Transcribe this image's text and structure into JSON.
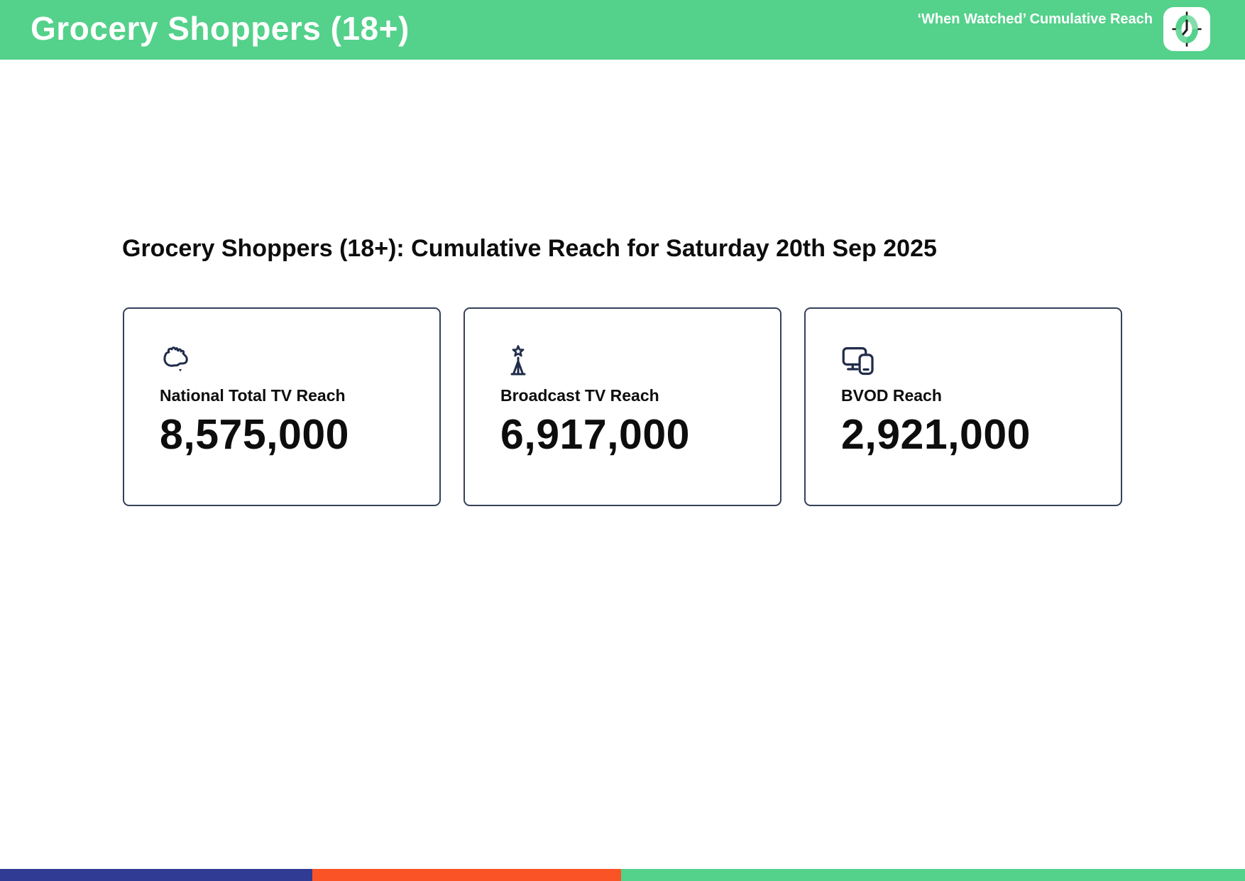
{
  "header": {
    "title": "Grocery Shoppers (18+)",
    "subtitle": "‘When Watched’ Cumulative Reach",
    "logo_icon": "clock-icon"
  },
  "main": {
    "heading": "Grocery Shoppers (18+): Cumulative Reach for Saturday 20th Sep 2025",
    "cards": [
      {
        "icon": "australia-map-icon",
        "label": "National Total TV Reach",
        "value": "8,575,000"
      },
      {
        "icon": "broadcast-tower-icon",
        "label": "Broadcast TV Reach",
        "value": "6,917,000"
      },
      {
        "icon": "tv-and-phone-icon",
        "label": "BVOD Reach",
        "value": "2,921,000"
      }
    ]
  },
  "colors": {
    "header_green": "#54d18b",
    "footer_blue": "#303b93",
    "footer_orange": "#fa5426",
    "footer_green": "#54d18b",
    "card_border": "#35415a",
    "icon_navy": "#202c4a",
    "text_black": "#0d0d0d"
  }
}
